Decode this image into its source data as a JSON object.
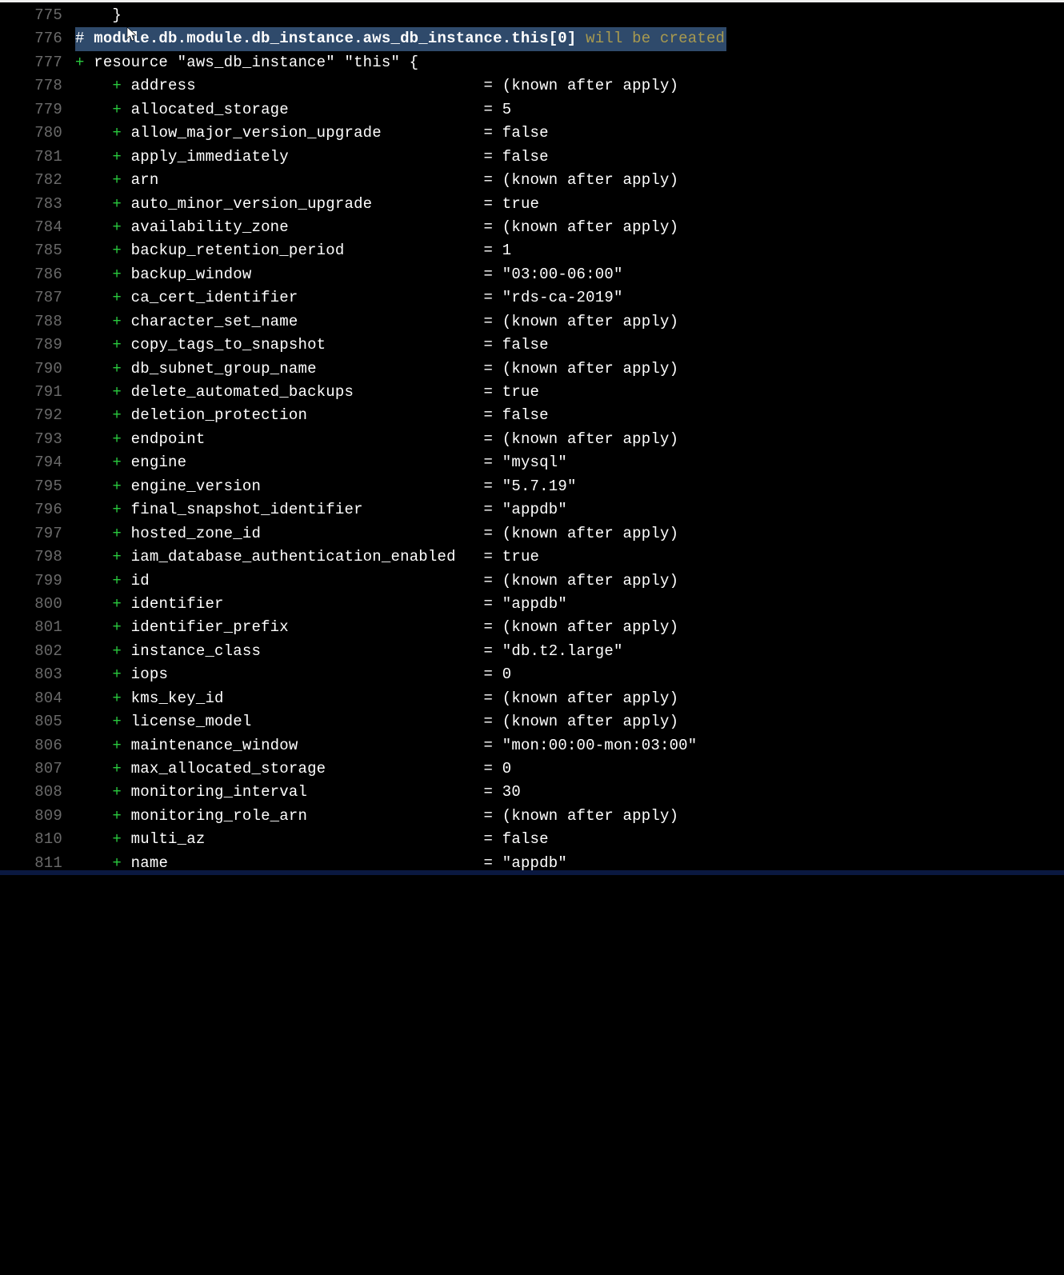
{
  "gutter_width_chars": 5,
  "lead_brace_line": {
    "num": "775",
    "text": "    }"
  },
  "comment_line": {
    "num": "776",
    "hash": "# ",
    "path": "module.db.module.db_instance.aws_db_instance.this[0]",
    "trail": " will be created"
  },
  "resource_line": {
    "num": "777",
    "plus": "+",
    "text": " resource \"aws_db_instance\" \"this\" {"
  },
  "key_col_width": 38,
  "rows": [
    {
      "num": "778",
      "key": "address",
      "val": "(known after apply)"
    },
    {
      "num": "779",
      "key": "allocated_storage",
      "val": "5"
    },
    {
      "num": "780",
      "key": "allow_major_version_upgrade",
      "val": "false"
    },
    {
      "num": "781",
      "key": "apply_immediately",
      "val": "false"
    },
    {
      "num": "782",
      "key": "arn",
      "val": "(known after apply)"
    },
    {
      "num": "783",
      "key": "auto_minor_version_upgrade",
      "val": "true"
    },
    {
      "num": "784",
      "key": "availability_zone",
      "val": "(known after apply)"
    },
    {
      "num": "785",
      "key": "backup_retention_period",
      "val": "1"
    },
    {
      "num": "786",
      "key": "backup_window",
      "val": "\"03:00-06:00\""
    },
    {
      "num": "787",
      "key": "ca_cert_identifier",
      "val": "\"rds-ca-2019\""
    },
    {
      "num": "788",
      "key": "character_set_name",
      "val": "(known after apply)"
    },
    {
      "num": "789",
      "key": "copy_tags_to_snapshot",
      "val": "false"
    },
    {
      "num": "790",
      "key": "db_subnet_group_name",
      "val": "(known after apply)"
    },
    {
      "num": "791",
      "key": "delete_automated_backups",
      "val": "true"
    },
    {
      "num": "792",
      "key": "deletion_protection",
      "val": "false"
    },
    {
      "num": "793",
      "key": "endpoint",
      "val": "(known after apply)"
    },
    {
      "num": "794",
      "key": "engine",
      "val": "\"mysql\""
    },
    {
      "num": "795",
      "key": "engine_version",
      "val": "\"5.7.19\""
    },
    {
      "num": "796",
      "key": "final_snapshot_identifier",
      "val": "\"appdb\""
    },
    {
      "num": "797",
      "key": "hosted_zone_id",
      "val": "(known after apply)"
    },
    {
      "num": "798",
      "key": "iam_database_authentication_enabled",
      "val": "true"
    },
    {
      "num": "799",
      "key": "id",
      "val": "(known after apply)"
    },
    {
      "num": "800",
      "key": "identifier",
      "val": "\"appdb\""
    },
    {
      "num": "801",
      "key": "identifier_prefix",
      "val": "(known after apply)"
    },
    {
      "num": "802",
      "key": "instance_class",
      "val": "\"db.t2.large\""
    },
    {
      "num": "803",
      "key": "iops",
      "val": "0"
    },
    {
      "num": "804",
      "key": "kms_key_id",
      "val": "(known after apply)"
    },
    {
      "num": "805",
      "key": "license_model",
      "val": "(known after apply)"
    },
    {
      "num": "806",
      "key": "maintenance_window",
      "val": "\"mon:00:00-mon:03:00\""
    },
    {
      "num": "807",
      "key": "max_allocated_storage",
      "val": "0"
    },
    {
      "num": "808",
      "key": "monitoring_interval",
      "val": "30"
    },
    {
      "num": "809",
      "key": "monitoring_role_arn",
      "val": "(known after apply)"
    },
    {
      "num": "810",
      "key": "multi_az",
      "val": "false"
    },
    {
      "num": "811",
      "key": "name",
      "val": "\"appdb\""
    }
  ]
}
